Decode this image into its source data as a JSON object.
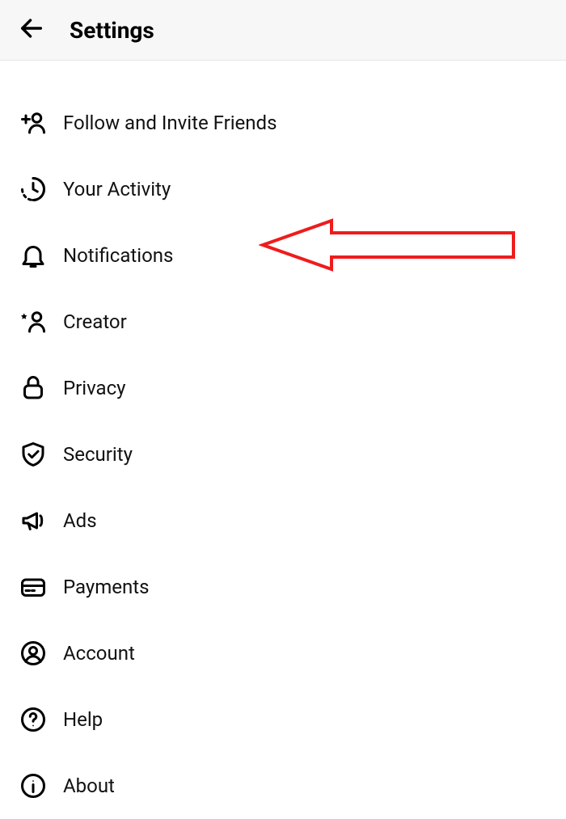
{
  "header": {
    "title": "Settings"
  },
  "menu": {
    "items": [
      {
        "icon": "follow-invite-icon",
        "label": "Follow and Invite Friends"
      },
      {
        "icon": "activity-icon",
        "label": "Your Activity"
      },
      {
        "icon": "notifications-icon",
        "label": "Notifications"
      },
      {
        "icon": "creator-icon",
        "label": "Creator"
      },
      {
        "icon": "privacy-icon",
        "label": "Privacy"
      },
      {
        "icon": "security-icon",
        "label": "Security"
      },
      {
        "icon": "ads-icon",
        "label": "Ads"
      },
      {
        "icon": "payments-icon",
        "label": "Payments"
      },
      {
        "icon": "account-icon",
        "label": "Account"
      },
      {
        "icon": "help-icon",
        "label": "Help"
      },
      {
        "icon": "about-icon",
        "label": "About"
      }
    ]
  },
  "annotation": {
    "target_item_index": 2,
    "color": "#ee1c1c"
  }
}
